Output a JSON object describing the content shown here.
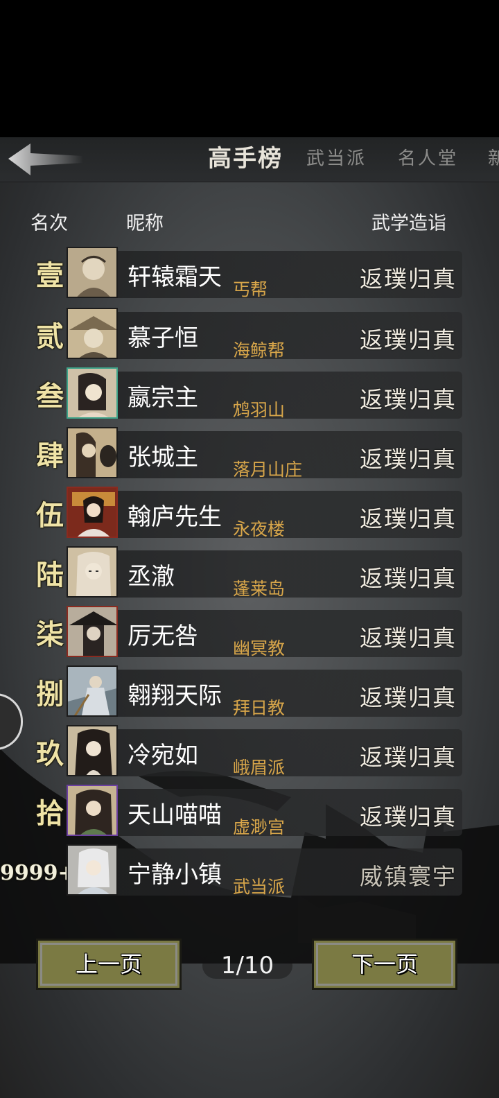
{
  "header": {
    "tabs": [
      {
        "label": "高手榜",
        "active": true
      },
      {
        "label": "武当派",
        "active": false
      },
      {
        "label": "名人堂",
        "active": false
      },
      {
        "label": "新",
        "active": false
      }
    ]
  },
  "columns": {
    "rank": "名次",
    "nickname": "昵称",
    "level": "武学造诣"
  },
  "rows": [
    {
      "rank": "壹",
      "name": "轩辕霜天",
      "sect": "丐帮",
      "level": "返璞归真"
    },
    {
      "rank": "贰",
      "name": "慕子恒",
      "sect": "海鲸帮",
      "level": "返璞归真"
    },
    {
      "rank": "叁",
      "name": "嬴宗主",
      "sect": "鸩羽山",
      "level": "返璞归真"
    },
    {
      "rank": "肆",
      "name": "张城主",
      "sect": "落月山庄",
      "level": "返璞归真"
    },
    {
      "rank": "伍",
      "name": "翰庐先生",
      "sect": "永夜楼",
      "level": "返璞归真"
    },
    {
      "rank": "陆",
      "name": "丞澈",
      "sect": "蓬莱岛",
      "level": "返璞归真"
    },
    {
      "rank": "柒",
      "name": "厉无咎",
      "sect": "幽冥教",
      "level": "返璞归真"
    },
    {
      "rank": "捌",
      "name": "翱翔天际",
      "sect": "拜日教",
      "level": "返璞归真"
    },
    {
      "rank": "玖",
      "name": "冷宛如",
      "sect": "峨眉派",
      "level": "返璞归真"
    },
    {
      "rank": "拾",
      "name": "天山喵喵",
      "sect": "虚渺宫",
      "level": "返璞归真"
    }
  ],
  "self_row": {
    "rank": "9999+",
    "name": "宁静小镇",
    "sect": "武当派",
    "level": "威镇寰宇"
  },
  "pagination": {
    "prev_label": "上一页",
    "next_label": "下一页",
    "indicator": "1/10"
  },
  "colors": {
    "rank_gold": "#efe3a6",
    "sect_gold": "#d8a64a",
    "button_olive": "#7b7a43"
  }
}
